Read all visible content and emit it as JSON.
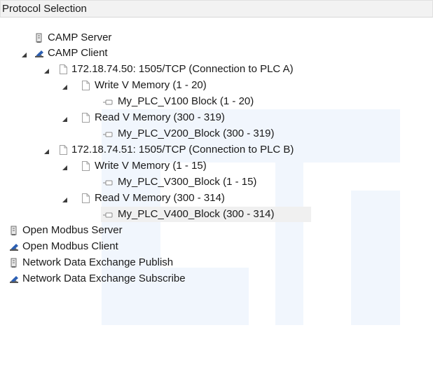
{
  "header": {
    "title": "Protocol Selection"
  },
  "tree": {
    "nodes": [
      {
        "label": "CAMP Server",
        "icon": "server-icon"
      },
      {
        "label": "CAMP Client",
        "icon": "client-icon",
        "expanded": true
      },
      {
        "label": "172.18.74.50: 1505/TCP (Connection to PLC A)",
        "icon": "document-icon",
        "expanded": true
      },
      {
        "label": "Write V Memory (1 - 20)",
        "icon": "document-icon",
        "expanded": true
      },
      {
        "label": "My_PLC_V100 Block (1 - 20)",
        "icon": "block-icon"
      },
      {
        "label": "Read V Memory (300 - 319)",
        "icon": "document-icon",
        "expanded": true
      },
      {
        "label": "My_PLC_V200_Block (300 - 319)",
        "icon": "block-icon"
      },
      {
        "label": "172.18.74.51: 1505/TCP (Connection to PLC B)",
        "icon": "document-icon",
        "expanded": true
      },
      {
        "label": "Write V Memory (1 - 15)",
        "icon": "document-icon",
        "expanded": true
      },
      {
        "label": "My_PLC_V300_Block (1 - 15)",
        "icon": "block-icon"
      },
      {
        "label": "Read V Memory (300 - 314)",
        "icon": "document-icon",
        "expanded": true
      },
      {
        "label": "My_PLC_V400_Block (300 - 314)",
        "icon": "block-icon",
        "selected": true
      },
      {
        "label": "Open Modbus Server",
        "icon": "server-icon"
      },
      {
        "label": "Open Modbus Client",
        "icon": "client-icon"
      },
      {
        "label": "Network Data Exchange Publish",
        "icon": "server-icon"
      },
      {
        "label": "Network Data Exchange Subscribe",
        "icon": "client-icon"
      }
    ]
  },
  "colors": {
    "header_bg": "#f2f2f2",
    "watermark": "#f1f6fd",
    "selected_bg": "#f0f0f0",
    "toggle": "#3c3c3c",
    "server_icon": "#6b6b6b",
    "client_icon_blue": "#2b5fb3"
  }
}
